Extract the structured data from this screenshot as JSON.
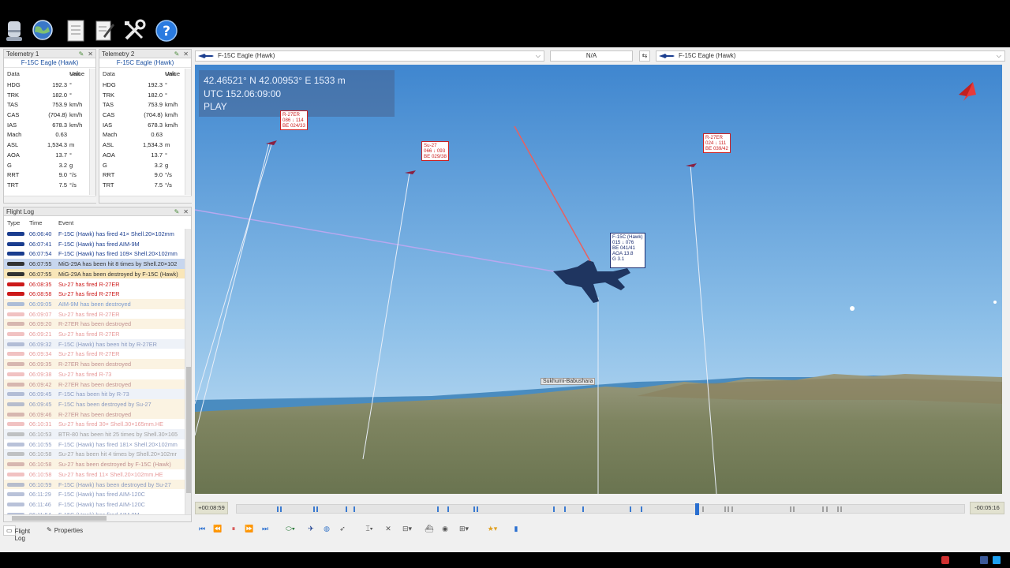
{
  "telemetry": [
    {
      "title": "Telemetry 1",
      "aircraft": "F-15C Eagle (Hawk)",
      "headers": {
        "data": "Data",
        "value": "Value",
        "unit": "Unit"
      },
      "rows": [
        {
          "data": "HDG",
          "value": "192.3",
          "unit": "°"
        },
        {
          "data": "TRK",
          "value": "182.0",
          "unit": "°"
        },
        {
          "data": "TAS",
          "value": "753.9",
          "unit": "km/h"
        },
        {
          "data": "CAS",
          "value": "(704.8)",
          "unit": "km/h"
        },
        {
          "data": "IAS",
          "value": "678.3",
          "unit": "km/h"
        },
        {
          "data": "Mach",
          "value": "0.63",
          "unit": ""
        },
        {
          "data": "ASL",
          "value": "1,534.3",
          "unit": "m"
        },
        {
          "data": "AOA",
          "value": "13.7",
          "unit": "°"
        },
        {
          "data": "G",
          "value": "3.2",
          "unit": "g"
        },
        {
          "data": "RRT",
          "value": "9.0",
          "unit": "°/s"
        },
        {
          "data": "TRT",
          "value": "7.5",
          "unit": "°/s"
        }
      ]
    },
    {
      "title": "Telemetry 2",
      "aircraft": "F-15C Eagle (Hawk)",
      "headers": {
        "data": "Data",
        "value": "Value",
        "unit": "Unit"
      },
      "rows": [
        {
          "data": "HDG",
          "value": "192.3",
          "unit": "°"
        },
        {
          "data": "TRK",
          "value": "182.0",
          "unit": "°"
        },
        {
          "data": "TAS",
          "value": "753.9",
          "unit": "km/h"
        },
        {
          "data": "CAS",
          "value": "(704.8)",
          "unit": "km/h"
        },
        {
          "data": "IAS",
          "value": "678.3",
          "unit": "km/h"
        },
        {
          "data": "Mach",
          "value": "0.63",
          "unit": ""
        },
        {
          "data": "ASL",
          "value": "1,534.3",
          "unit": "m"
        },
        {
          "data": "AOA",
          "value": "13.7",
          "unit": "°"
        },
        {
          "data": "G",
          "value": "3.2",
          "unit": "g"
        },
        {
          "data": "RRT",
          "value": "9.0",
          "unit": "°/s"
        },
        {
          "data": "TRT",
          "value": "7.5",
          "unit": "°/s"
        }
      ]
    }
  ],
  "flight_log": {
    "title": "Flight Log",
    "headers": {
      "type": "Type",
      "time": "Time",
      "event": "Event"
    },
    "rows": [
      {
        "time": "06:06:40",
        "event": "F-15C (Hawk) has fired 41× Shell.20×102mm",
        "color": "#1a3d8f",
        "bg": "",
        "faded": false
      },
      {
        "time": "06:07:41",
        "event": "F-15C (Hawk) has fired AIM-9M",
        "color": "#1a3d8f",
        "bg": "",
        "faded": false
      },
      {
        "time": "06:07:54",
        "event": "F-15C (Hawk) has fired 109× Shell.20×102mm",
        "color": "#1a3d8f",
        "bg": "",
        "faded": false
      },
      {
        "time": "06:07:55",
        "event": "MiG-29A has been hit 8 times by Shell.20×102",
        "color": "#333333",
        "bg": "#c7d6ee",
        "faded": false
      },
      {
        "time": "06:07:55",
        "event": "MiG-29A has been destroyed by F-15C (Hawk)",
        "color": "#333333",
        "bg": "#f9e6b8",
        "faded": false
      },
      {
        "time": "06:08:35",
        "event": "Su-27 has fired R-27ER",
        "color": "#cc1a1a",
        "bg": "",
        "faded": false
      },
      {
        "time": "06:08:58",
        "event": "Su-27 has fired R-27ER",
        "color": "#cc1a1a",
        "bg": "",
        "faded": false
      },
      {
        "time": "06:09:05",
        "event": "AIM-9M has been destroyed",
        "color": "#7a9ad0",
        "bg": "#fbf3e2",
        "faded": true
      },
      {
        "time": "06:09:07",
        "event": "Su-27 has fired R-27ER",
        "color": "#e79a9a",
        "bg": "",
        "faded": true
      },
      {
        "time": "06:09:20",
        "event": "R-27ER has been destroyed",
        "color": "#c09090",
        "bg": "#fbf3e2",
        "faded": true
      },
      {
        "time": "06:09:21",
        "event": "Su-27 has fired R-27ER",
        "color": "#e79a9a",
        "bg": "",
        "faded": true
      },
      {
        "time": "06:09:32",
        "event": "F-15C (Hawk) has been hit by R-27ER",
        "color": "#8a9ac0",
        "bg": "#eef2f8",
        "faded": true
      },
      {
        "time": "06:09:34",
        "event": "Su-27 has fired R-27ER",
        "color": "#e79a9a",
        "bg": "",
        "faded": true
      },
      {
        "time": "06:09:35",
        "event": "R-27ER has been destroyed",
        "color": "#c09090",
        "bg": "#fbf3e2",
        "faded": true
      },
      {
        "time": "06:09:38",
        "event": "Su-27 has fired R-73",
        "color": "#e79a9a",
        "bg": "",
        "faded": true
      },
      {
        "time": "06:09:42",
        "event": "R-27ER has been destroyed",
        "color": "#c09090",
        "bg": "#fbf3e2",
        "faded": true
      },
      {
        "time": "06:09:45",
        "event": "F-15C has been hit by R-73",
        "color": "#8a9ac0",
        "bg": "#eef2f8",
        "faded": true
      },
      {
        "time": "06:09:45",
        "event": "F-15C has been destroyed by Su-27",
        "color": "#8a9ac0",
        "bg": "#fbf3e2",
        "faded": true
      },
      {
        "time": "06:09:46",
        "event": "R-27ER has been destroyed",
        "color": "#c09090",
        "bg": "#fbf3e2",
        "faded": true
      },
      {
        "time": "06:10:31",
        "event": "Su-27 has fired 30× Shell.30×165mm.HE",
        "color": "#e79a9a",
        "bg": "",
        "faded": true
      },
      {
        "time": "06:10:53",
        "event": "BTR-80 has been hit 25 times by Shell.30×165",
        "color": "#a0a0a0",
        "bg": "#eef2f8",
        "faded": true
      },
      {
        "time": "06:10:55",
        "event": "F-15C (Hawk) has fired 181× Shell.20×102mm",
        "color": "#8a9ac0",
        "bg": "",
        "faded": true
      },
      {
        "time": "06:10:58",
        "event": "Su-27 has been hit 4 times by Shell.20×102mr",
        "color": "#a0a0a0",
        "bg": "#eef2f8",
        "faded": true
      },
      {
        "time": "06:10:58",
        "event": "Su-27 has been destroyed by F-15C (Hawk)",
        "color": "#c09090",
        "bg": "#fbf3e2",
        "faded": true
      },
      {
        "time": "06:10:58",
        "event": "Su-27 has fired 11× Shell.20×102mm.HE",
        "color": "#e79a9a",
        "bg": "",
        "faded": true
      },
      {
        "time": "06:10:59",
        "event": "F-15C (Hawk) has been destroyed by Su-27",
        "color": "#8a9ac0",
        "bg": "#fbf3e2",
        "faded": true
      },
      {
        "time": "06:11:29",
        "event": "F-15C (Hawk) has fired AIM-120C",
        "color": "#8a9ac0",
        "bg": "",
        "faded": true
      },
      {
        "time": "06:11:46",
        "event": "F-15C (Hawk) has fired AIM-120C",
        "color": "#8a9ac0",
        "bg": "",
        "faded": true
      },
      {
        "time": "06:11:54",
        "event": "F-15C (Hawk) has fired AIM-9M",
        "color": "#8a9ac0",
        "bg": "",
        "faded": true
      }
    ]
  },
  "bottom_tabs": {
    "flight_log": "Flight Log",
    "properties": "Properties"
  },
  "view_bar": {
    "left_aircraft": "F-15C Eagle (Hawk)",
    "middle": "N/A",
    "right_aircraft": "F-15C Eagle (Hawk)"
  },
  "hud": {
    "position": "42.46521° N  42.00953° E  1533 m",
    "utc": "UTC 152.06:09:00",
    "state": "PLAY"
  },
  "labels": {
    "r27er_1": [
      "R-27ER",
      "086 ↓ 114",
      "BE 024/33"
    ],
    "su27": [
      "Su-27",
      "066 ↓ 093",
      "BE 029/38"
    ],
    "r27er_2": [
      "R-27ER",
      "024 ↓ 111",
      "BE 039/42"
    ],
    "f15c": [
      "F-15C (Hawk)",
      "015 ↓ 076",
      "BE 041/41",
      "AOA 13.8",
      "G 3.1"
    ],
    "airfield": "Sukhumi-Babushara"
  },
  "timeline": {
    "elapsed": "+00:08:59",
    "remaining": "-00:05:16",
    "position_fraction": 0.63
  },
  "colors": {
    "blue_coalition": "#1a3d8f",
    "red_coalition": "#cc1a1a",
    "accent": "#2a6fd0"
  }
}
